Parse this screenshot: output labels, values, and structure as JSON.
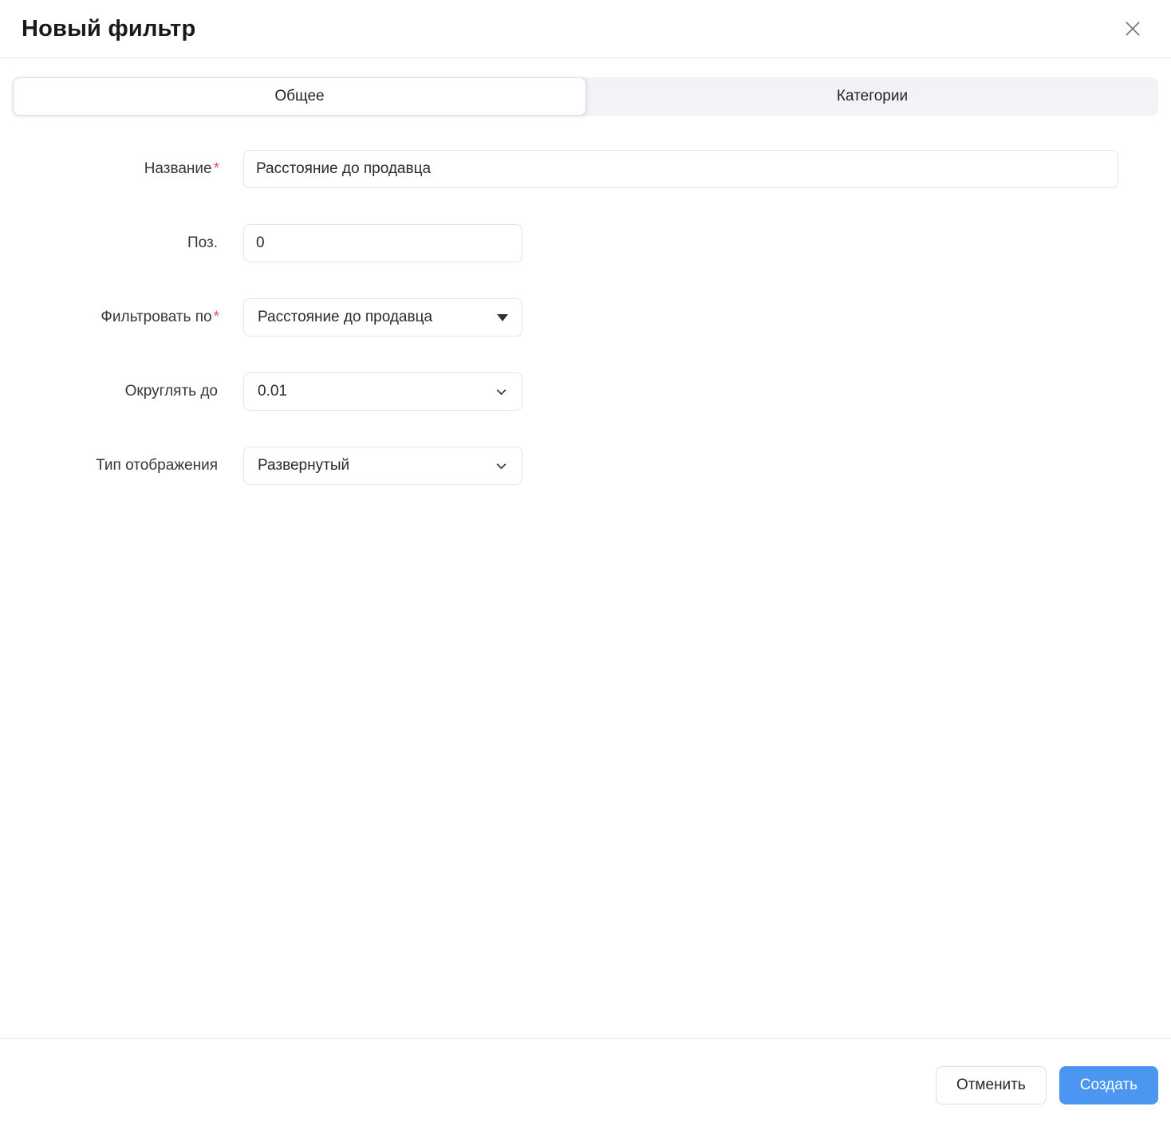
{
  "modal": {
    "title": "Новый фильтр"
  },
  "tabs": {
    "general": {
      "label": "Общее",
      "active": true
    },
    "categories": {
      "label": "Категории",
      "active": false
    }
  },
  "form": {
    "fields": [
      {
        "label": "Название",
        "required_mark": "*",
        "type": "text",
        "value": "Расстояние до продавца"
      },
      {
        "label": "Поз.",
        "type": "text",
        "value": "0"
      },
      {
        "label": "Фильтровать по",
        "required_mark": "*",
        "type": "select",
        "value": "Расстояние до продавца"
      },
      {
        "label": "Округлять до",
        "type": "select",
        "value": "0.01"
      },
      {
        "label": "Тип отображения",
        "type": "select",
        "value": "Развернутый"
      }
    ]
  },
  "footer": {
    "cancel_label": "Отменить",
    "create_label": "Создать"
  },
  "icons": {
    "close": "close-icon",
    "filter_caret": "caret-down-filled-icon",
    "select_caret": "chevron-down-icon"
  },
  "colors": {
    "primary": "#4a96f0",
    "required": "#ef5350",
    "tab_inactive_bg": "#f1f3f6",
    "input_border": "#dfe5ec"
  }
}
